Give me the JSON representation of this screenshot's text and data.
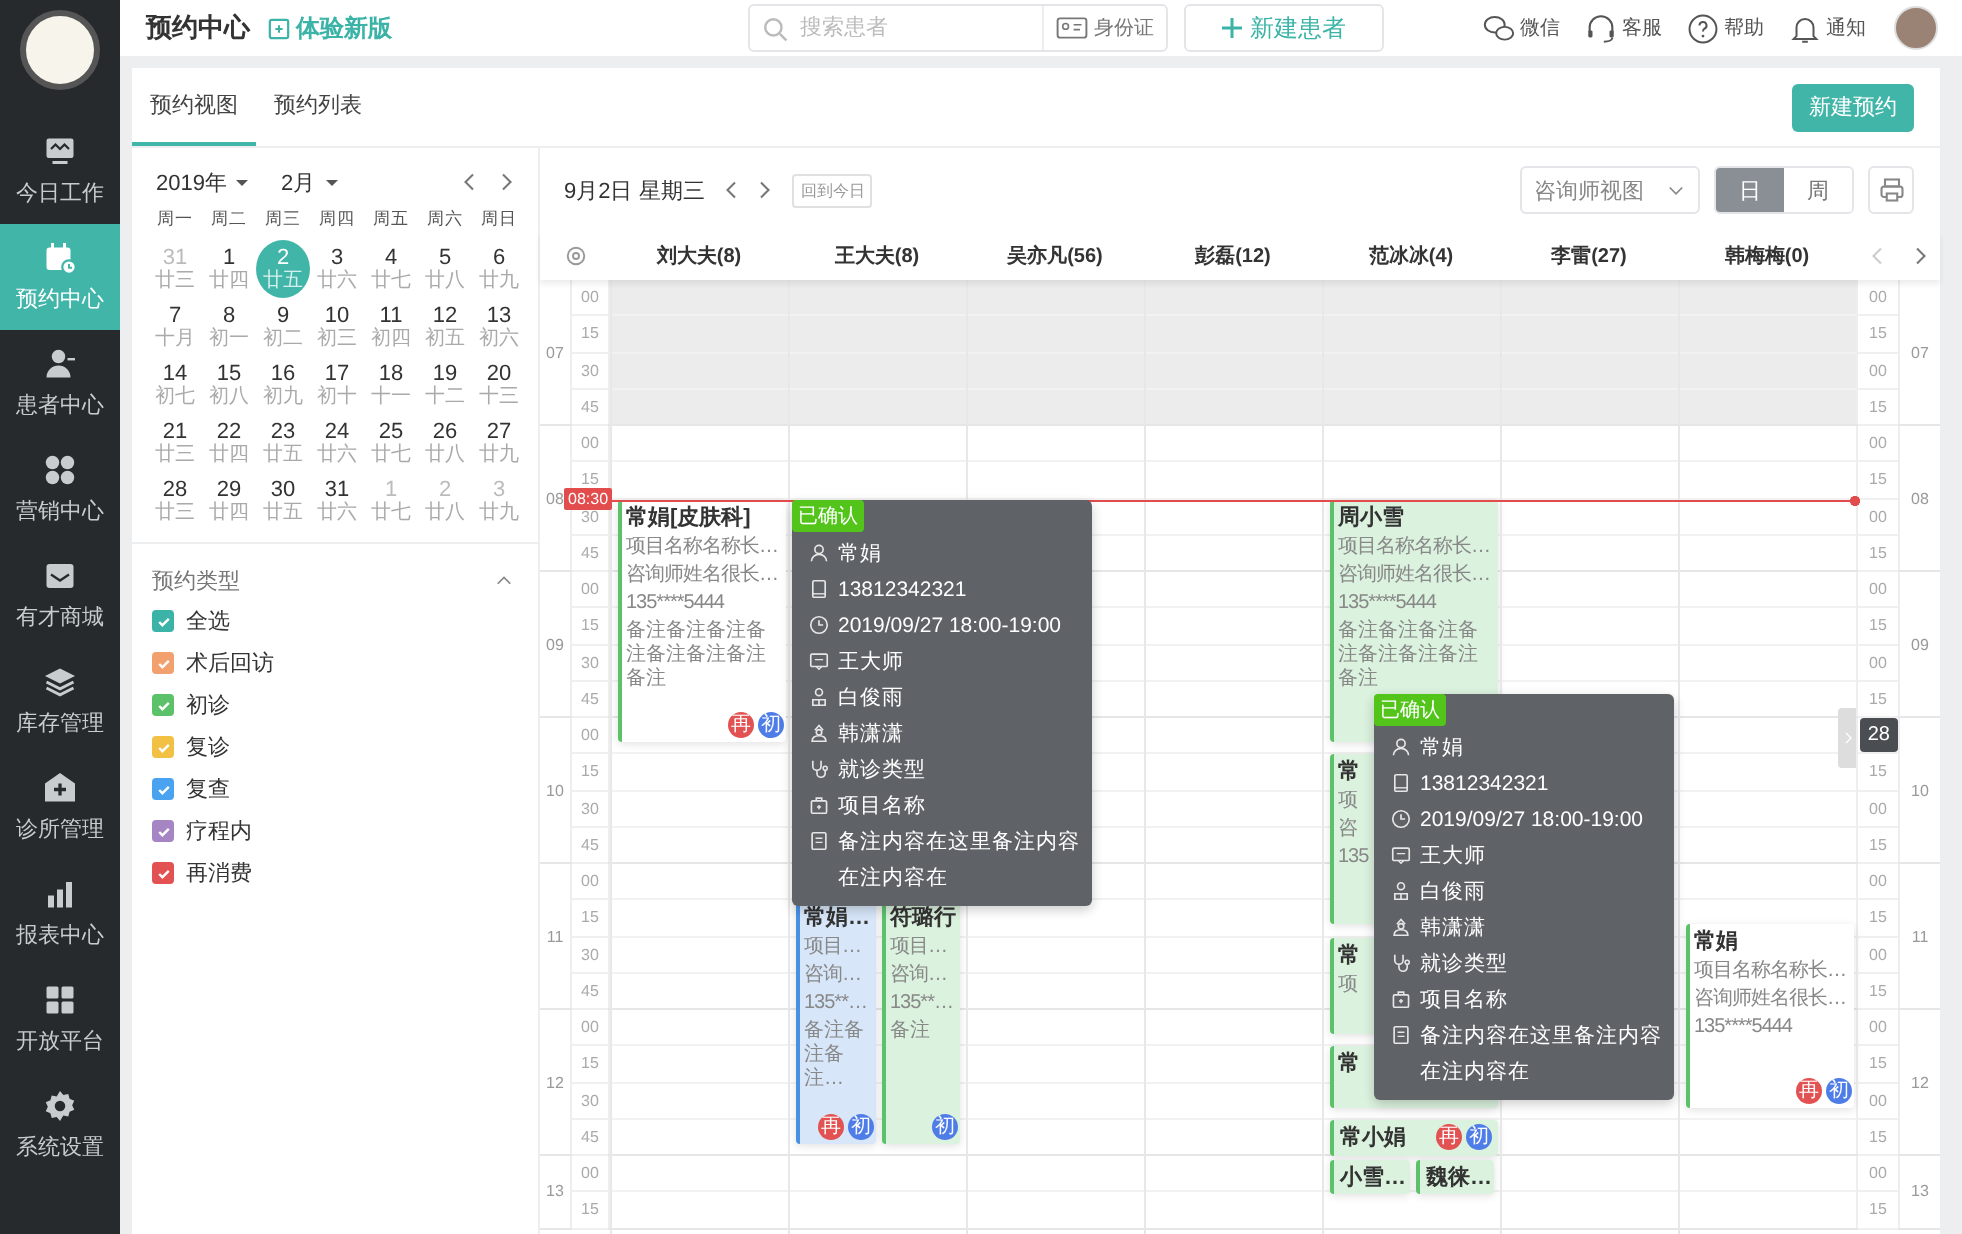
{
  "sidebar": {
    "items": [
      {
        "label": "今日工作",
        "selected": false
      },
      {
        "label": "预约中心",
        "selected": true
      },
      {
        "label": "患者中心",
        "selected": false
      },
      {
        "label": "营销中心",
        "selected": false
      },
      {
        "label": "有才商城",
        "selected": false
      },
      {
        "label": "库存管理",
        "selected": false
      },
      {
        "label": "诊所管理",
        "selected": false
      },
      {
        "label": "报表中心",
        "selected": false
      },
      {
        "label": "开放平台",
        "selected": false
      },
      {
        "label": "系统设置",
        "selected": false
      }
    ]
  },
  "header": {
    "title": "预约中心",
    "new_version_link": "体验新版",
    "search": {
      "placeholder": "搜索患者",
      "id_card_button": "身份证"
    },
    "new_patient_button": "新建患者",
    "tools": [
      "微信",
      "客服",
      "帮助",
      "通知"
    ]
  },
  "tabs": [
    {
      "label": "预约视图",
      "selected": true
    },
    {
      "label": "预约列表",
      "selected": false
    }
  ],
  "new_appointment_button": "新建预约",
  "calendar": {
    "year": "2019年",
    "month": "2月",
    "weekdays": [
      "周一",
      "周二",
      "周三",
      "周四",
      "周五",
      "周六",
      "周日"
    ],
    "weeks": [
      [
        {
          "day": "31",
          "lunar": "廿三",
          "muted": true,
          "selected": false
        },
        {
          "day": "1",
          "lunar": "廿四",
          "muted": false,
          "selected": false
        },
        {
          "day": "2",
          "lunar": "廿五",
          "muted": false,
          "selected": true
        },
        {
          "day": "3",
          "lunar": "廿六",
          "muted": false,
          "selected": false
        },
        {
          "day": "4",
          "lunar": "廿七",
          "muted": false,
          "selected": false
        },
        {
          "day": "5",
          "lunar": "廿八",
          "muted": false,
          "selected": false
        },
        {
          "day": "6",
          "lunar": "廿九",
          "muted": false,
          "selected": false
        }
      ],
      [
        {
          "day": "7",
          "lunar": "十月",
          "muted": false,
          "selected": false
        },
        {
          "day": "8",
          "lunar": "初一",
          "muted": false,
          "selected": false
        },
        {
          "day": "9",
          "lunar": "初二",
          "muted": false,
          "selected": false
        },
        {
          "day": "10",
          "lunar": "初三",
          "muted": false,
          "selected": false
        },
        {
          "day": "11",
          "lunar": "初四",
          "muted": false,
          "selected": false
        },
        {
          "day": "12",
          "lunar": "初五",
          "muted": false,
          "selected": false
        },
        {
          "day": "13",
          "lunar": "初六",
          "muted": false,
          "selected": false
        }
      ],
      [
        {
          "day": "14",
          "lunar": "初七",
          "muted": false,
          "selected": false
        },
        {
          "day": "15",
          "lunar": "初八",
          "muted": false,
          "selected": false
        },
        {
          "day": "16",
          "lunar": "初九",
          "muted": false,
          "selected": false
        },
        {
          "day": "17",
          "lunar": "初十",
          "muted": false,
          "selected": false
        },
        {
          "day": "18",
          "lunar": "十一",
          "muted": false,
          "selected": false
        },
        {
          "day": "19",
          "lunar": "十二",
          "muted": false,
          "selected": false
        },
        {
          "day": "20",
          "lunar": "十三",
          "muted": false,
          "selected": false
        }
      ],
      [
        {
          "day": "21",
          "lunar": "廿三",
          "muted": false,
          "selected": false
        },
        {
          "day": "22",
          "lunar": "廿四",
          "muted": false,
          "selected": false
        },
        {
          "day": "23",
          "lunar": "廿五",
          "muted": false,
          "selected": false
        },
        {
          "day": "24",
          "lunar": "廿六",
          "muted": false,
          "selected": false
        },
        {
          "day": "25",
          "lunar": "廿七",
          "muted": false,
          "selected": false
        },
        {
          "day": "26",
          "lunar": "廿八",
          "muted": false,
          "selected": false
        },
        {
          "day": "27",
          "lunar": "廿九",
          "muted": false,
          "selected": false
        }
      ],
      [
        {
          "day": "28",
          "lunar": "廿三",
          "muted": false,
          "selected": false
        },
        {
          "day": "29",
          "lunar": "廿四",
          "muted": false,
          "selected": false
        },
        {
          "day": "30",
          "lunar": "廿五",
          "muted": false,
          "selected": false
        },
        {
          "day": "31",
          "lunar": "廿六",
          "muted": false,
          "selected": false
        },
        {
          "day": "1",
          "lunar": "廿七",
          "muted": true,
          "selected": false
        },
        {
          "day": "2",
          "lunar": "廿八",
          "muted": true,
          "selected": false
        },
        {
          "day": "3",
          "lunar": "廿九",
          "muted": true,
          "selected": false
        }
      ]
    ]
  },
  "legend": {
    "title": "预约类型",
    "expanded": true,
    "items": [
      {
        "label": "全选",
        "checked": true,
        "color": "#3bb3a6"
      },
      {
        "label": "术后回访",
        "checked": true,
        "color": "#f2a06e"
      },
      {
        "label": "初诊",
        "checked": true,
        "color": "#5cc26a"
      },
      {
        "label": "复诊",
        "checked": true,
        "color": "#f2c043"
      },
      {
        "label": "复查",
        "checked": true,
        "color": "#4aa3f0"
      },
      {
        "label": "疗程内",
        "checked": true,
        "color": "#a585c4"
      },
      {
        "label": "再消费",
        "checked": true,
        "color": "#e25252"
      }
    ]
  },
  "schedule": {
    "date": "9月2日 星期三",
    "today_button": "回到今日",
    "view_select": "咨询师视图",
    "modes": [
      {
        "label": "日",
        "selected": true
      },
      {
        "label": "周",
        "selected": false
      }
    ],
    "prev_disabled": true,
    "now_label": "08:30",
    "hidden_count": "28",
    "hours": [
      {
        "hour": "07",
        "minutes": [
          "00",
          "15",
          "30",
          "45"
        ],
        "right_minutes": [
          "00",
          "15",
          "00",
          "15"
        ],
        "right_hour": "07",
        "closed": true
      },
      {
        "hour": "08",
        "minutes": [
          "00",
          "15",
          "30",
          "45"
        ],
        "right_minutes": [
          "00",
          "15",
          "00",
          "15"
        ],
        "right_hour": "08",
        "closed": false
      },
      {
        "hour": "09",
        "minutes": [
          "00",
          "15",
          "30",
          "45"
        ],
        "right_minutes": [
          "00",
          "15",
          "00",
          "15"
        ],
        "right_hour": "09",
        "closed": false
      },
      {
        "hour": "10",
        "minutes": [
          "00",
          "15",
          "30",
          "45"
        ],
        "right_minutes": [
          "15",
          "00",
          "15"
        ],
        "right_hour": "10",
        "closed": false
      },
      {
        "hour": "11",
        "minutes": [
          "00",
          "15",
          "30",
          "45"
        ],
        "right_minutes": [
          "00",
          "15",
          "00",
          "15"
        ],
        "right_hour": "11",
        "closed": false
      },
      {
        "hour": "12",
        "minutes": [
          "00",
          "15",
          "30",
          "45"
        ],
        "right_minutes": [
          "00",
          "15",
          "00",
          "15"
        ],
        "right_hour": "12",
        "closed": false
      },
      {
        "hour": "13",
        "minutes": [
          "00",
          "15"
        ],
        "right_minutes": [
          "00",
          "15"
        ],
        "right_hour": "13",
        "closed": false
      }
    ],
    "columns": [
      {
        "name": "刘大夫(8)",
        "events": [
          {
            "title": "常娟[皮肤科]",
            "lines": [
              "项目名称名称长…",
              "咨询师姓名很长…",
              "135****5444"
            ],
            "note": "备注备注备注备注备注备注备注备注",
            "badges": [
              {
                "text": "再",
                "color": "#e25252"
              },
              {
                "text": "初",
                "color": "#4f7de8"
              }
            ],
            "color": "#5cc26a",
            "popover": {
              "status": "已确认",
              "rows": [
                "常娟",
                "13812342321",
                "2019/09/27 18:00-19:00",
                "王大师",
                "白俊雨",
                "韩潇潇",
                "就诊类型",
                "项目名称",
                "备注内容在这里备注内容在注内容在"
              ]
            }
          }
        ]
      },
      {
        "name": "王大夫(8)",
        "events": [
          {
            "title": "常娟…",
            "lines": [
              "项目…",
              "咨询…",
              "135**…"
            ],
            "note": "备注备注备注…",
            "badges": [
              {
                "text": "再",
                "color": "#e25252"
              },
              {
                "text": "初",
                "color": "#4f7de8"
              }
            ],
            "color": "#4a90e2"
          },
          {
            "title": "符璐行",
            "lines": [
              "项目…",
              "咨询…",
              "135**…"
            ],
            "note": "备注",
            "badges": [
              {
                "text": "初",
                "color": "#4f7de8"
              }
            ],
            "color": "#5cc26a"
          }
        ]
      },
      {
        "name": "吴亦凡(56)"
      },
      {
        "name": "彭磊(12)"
      },
      {
        "name": "范冰冰(4)",
        "events": [
          {
            "title": "周小雪",
            "lines": [
              "项目名称名称长…",
              "咨询师姓名很长…",
              "135****5444"
            ],
            "note": "备注备注备注备注备注备注备注备注",
            "color": "#5cc26a"
          },
          {
            "title": "常",
            "lines": [
              "项",
              "咨",
              "135"
            ],
            "color": "#5cc26a"
          },
          {
            "title": "常",
            "lines": [
              "项"
            ],
            "color": "#5cc26a"
          },
          {
            "title": "常",
            "color": "#5cc26a"
          },
          {
            "title": "常小娟",
            "badges": [
              {
                "text": "再",
                "color": "#e25252"
              },
              {
                "text": "初",
                "color": "#4f7de8"
              }
            ],
            "color": "#5cc26a"
          },
          {
            "title": "小雪…",
            "color": "#5cc26a"
          },
          {
            "title": "魏徕…",
            "color": "#5cc26a"
          }
        ]
      },
      {
        "name": "李雷(27)"
      },
      {
        "name": "韩梅梅(0)",
        "events": [
          {
            "title": "常娟",
            "lines": [
              "项目名称名称长…",
              "咨询师姓名很长…",
              "135****5444"
            ],
            "badges": [
              {
                "text": "再",
                "color": "#e25252"
              },
              {
                "text": "初",
                "color": "#4f7de8"
              }
            ],
            "color": "#5cc26a",
            "popover": {
              "status": "已确认",
              "rows": [
                "常娟",
                "13812342321",
                "2019/09/27 18:00-19:00",
                "王大师",
                "白俊雨",
                "韩潇潇",
                "就诊类型",
                "项目名称",
                "备注内容在这里备注内容在注内容在"
              ]
            }
          }
        ]
      }
    ]
  }
}
